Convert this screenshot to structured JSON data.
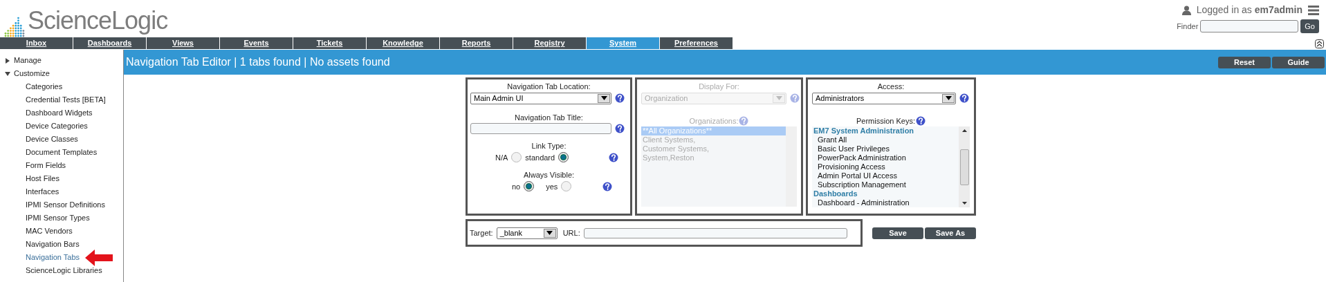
{
  "logo": {
    "text": "ScienceLogic"
  },
  "user": {
    "prefix": "Logged in as",
    "name": "em7admin"
  },
  "finder": {
    "label": "Finder",
    "button": "Go"
  },
  "tabs": [
    {
      "label": "Inbox",
      "selected": false
    },
    {
      "label": "Dashboards",
      "selected": false
    },
    {
      "label": "Views",
      "selected": false
    },
    {
      "label": "Events",
      "selected": false
    },
    {
      "label": "Tickets",
      "selected": false
    },
    {
      "label": "Knowledge",
      "selected": false
    },
    {
      "label": "Reports",
      "selected": false
    },
    {
      "label": "Registry",
      "selected": false
    },
    {
      "label": "System",
      "selected": true
    },
    {
      "label": "Preferences",
      "selected": false
    }
  ],
  "sidebar": [
    {
      "label": "Manage",
      "expanded": false
    },
    {
      "label": "Customize",
      "expanded": true,
      "children": [
        {
          "label": "Categories",
          "selected": false
        },
        {
          "label": "Credential Tests [BETA]",
          "selected": false
        },
        {
          "label": "Dashboard Widgets",
          "selected": false
        },
        {
          "label": "Device Categories",
          "selected": false
        },
        {
          "label": "Device Classes",
          "selected": false
        },
        {
          "label": "Document Templates",
          "selected": false
        },
        {
          "label": "Form Fields",
          "selected": false
        },
        {
          "label": "Host Files",
          "selected": false
        },
        {
          "label": "Interfaces",
          "selected": false
        },
        {
          "label": "IPMI Sensor Definitions",
          "selected": false
        },
        {
          "label": "IPMI Sensor Types",
          "selected": false
        },
        {
          "label": "MAC Vendors",
          "selected": false
        },
        {
          "label": "Navigation Bars",
          "selected": false
        },
        {
          "label": "Navigation Tabs",
          "selected": true
        },
        {
          "label": "ScienceLogic Libraries",
          "selected": false
        }
      ]
    }
  ],
  "header": {
    "title": "Navigation Tab Editor | 1 tabs found | No assets found",
    "buttons": [
      "Reset",
      "Guide"
    ]
  },
  "form": {
    "location": {
      "label": "Navigation Tab Location:",
      "value": "Main Admin UI"
    },
    "title": {
      "label": "Navigation Tab Title:"
    },
    "link_type": {
      "label": "Link Type:",
      "options": [
        {
          "label": "N/A",
          "selected": false
        },
        {
          "label": "standard",
          "selected": true
        }
      ]
    },
    "always_visible": {
      "label": "Always Visible:",
      "options": [
        {
          "label": "no",
          "selected": true
        },
        {
          "label": "yes",
          "selected": false
        }
      ]
    },
    "display_for": {
      "label": "Display For:",
      "value": "Organization",
      "disabled": true
    },
    "organizations": {
      "label": "Organizations:",
      "disabled": true,
      "items": [
        {
          "label": "**All Organizations**",
          "selected": true
        },
        {
          "label": "Client Systems,",
          "selected": false
        },
        {
          "label": "Customer Systems,",
          "selected": false
        },
        {
          "label": "System,Reston",
          "selected": false
        }
      ]
    },
    "access": {
      "label": "Access:",
      "value": "Administrators"
    },
    "permission_keys": {
      "label": "Permission Keys:",
      "items": [
        {
          "kind": "group",
          "label": "EM7 System Administration"
        },
        {
          "kind": "item",
          "label": "Grant All"
        },
        {
          "kind": "item",
          "label": "Basic User Privileges"
        },
        {
          "kind": "item",
          "label": "PowerPack Administration"
        },
        {
          "kind": "item",
          "label": "Provisioning Access"
        },
        {
          "kind": "item",
          "label": "Admin Portal UI Access"
        },
        {
          "kind": "item",
          "label": "Subscription Management"
        },
        {
          "kind": "group",
          "label": "Dashboards"
        },
        {
          "kind": "item",
          "label": "Dashboard - Administration"
        }
      ]
    },
    "target": {
      "label": "Target:",
      "value": "_blank"
    },
    "url": {
      "label": "URL:"
    },
    "buttons": [
      "Save",
      "Save As"
    ]
  }
}
